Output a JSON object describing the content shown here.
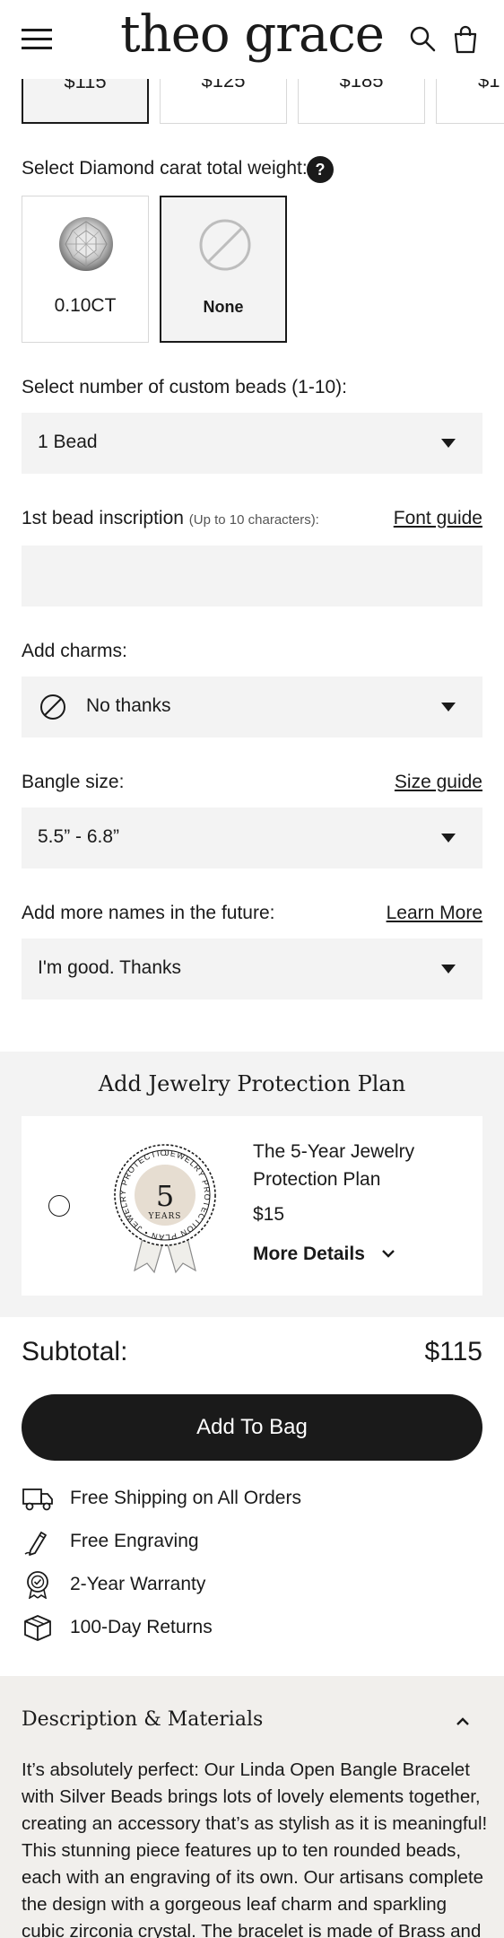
{
  "header": {
    "logo": "theo grace",
    "menu_icon": "hamburger-menu-icon",
    "search_icon": "search-icon",
    "bag_icon": "shopping-bag-icon"
  },
  "price_options": [
    "$115",
    "$125",
    "$185",
    "$1"
  ],
  "carat": {
    "label": "Select Diamond carat total weight:",
    "help": "?",
    "options": [
      {
        "label": "0.10CT",
        "icon": "diamond-icon"
      },
      {
        "label": "None",
        "icon": "none-icon"
      }
    ],
    "selected": "None"
  },
  "beads": {
    "label": "Select number of custom beads (1-10):",
    "value": "1 Bead"
  },
  "inscription": {
    "label": "1st bead inscription",
    "hint": "(Up to 10 characters):",
    "link": "Font guide",
    "value": ""
  },
  "charms": {
    "label": "Add charms:",
    "value": "No thanks",
    "icon": "no-selection-icon"
  },
  "bangle": {
    "label": "Bangle size:",
    "link": "Size guide",
    "value": "5.5” - 6.8”"
  },
  "future_names": {
    "label": "Add more names in the future:",
    "link": "Learn More",
    "value": "I'm good. Thanks"
  },
  "protection": {
    "title": "Add Jewelry Protection Plan",
    "plan_name": "The 5-Year Jewelry Protection Plan",
    "price": "$15",
    "more": "More Details",
    "badge_number": "5",
    "badge_unit": "YEARS",
    "badge_ring_text": "JEWELRY PROTECTION PLAN • JEWELRY PROTECTION PLAN •"
  },
  "subtotal": {
    "label": "Subtotal:",
    "value": "$115"
  },
  "cta": "Add To Bag",
  "perks": [
    {
      "text": "Free Shipping on All Orders",
      "icon": "truck-icon"
    },
    {
      "text": "Free Engraving",
      "icon": "engraving-pen-icon"
    },
    {
      "text": "2-Year Warranty",
      "icon": "warranty-badge-icon"
    },
    {
      "text": "100-Day Returns",
      "icon": "box-icon"
    }
  ],
  "description": {
    "title": "Description & Materials",
    "body": "It’s absolutely perfect: Our Linda Open Bangle Bracelet with Silver Beads brings lots of lovely elements together, creating an accessory that’s as stylish as it is meaningful! This stunning piece features up to ten rounded beads, each with an engraving of its own. Our artisans complete the design with a gorgeous leaf charm and sparkling cubic zirconia crystal. The bracelet is made of Brass and"
  }
}
